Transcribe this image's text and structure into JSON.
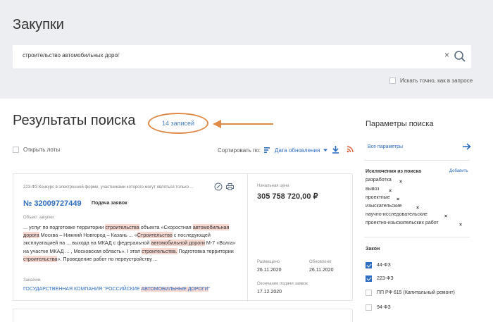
{
  "page": {
    "title": "Закупки"
  },
  "search": {
    "query": "строительство автомобильных дорог",
    "clear_icon": "close-icon",
    "exact_match_label": "Искать точно, как в запросе"
  },
  "results": {
    "title": "Результаты поиска",
    "count": "14 записей",
    "open_lots_label": "Открыть лоты",
    "sort_label": "Сортировать по:",
    "sort_value": "Дата обновления"
  },
  "card": {
    "type": "223-ФЗ Конкурс в электронной форме, участниками которого могут являться только ...",
    "number": "№ 32009727449",
    "status": "Подача заявок",
    "object_label": "Объект закупки",
    "object_parts": {
      "p1": "... услуг по подготовке территории ",
      "h1": "строительства",
      "p2": " объекта «Скоростная ",
      "h2": "автомобильная дорога",
      "p3": " Москва – Нижний Новгород – Казань ... «",
      "h3": "Строительство",
      "p4": " с последующей эксплуатацией на ... выхода на МКАД с федеральной ",
      "h4": "автомобильной дороги",
      "p5": " М-7 «Волга» на участке МКАД ... , Московская область». I этап ",
      "h5": "строительства.",
      "p6": " Подготовка территории ",
      "h6": "строительства",
      "p7": "». Проведение работ по переустройству ..."
    },
    "customer_label": "Заказчик",
    "customer_parts": {
      "p1": "ГОСУДАРСТВЕННАЯ КОМПАНИЯ \"РОССИЙСКИЕ ",
      "h1": "АВТОМОБИЛЬНЫЕ ДОРОГИ",
      "p2": "\""
    },
    "price_label": "Начальная цена",
    "price": "305 758 720,00 ₽",
    "placed_label": "Размещено",
    "placed": "26.11.2020",
    "updated_label": "Обновлено",
    "updated": "26.11.2020",
    "end_label": "Окончание подачи заявок",
    "end": "17.12.2020"
  },
  "sidebar": {
    "title": "Параметры поиска",
    "all_params": "Все параметры",
    "exclusions_title": "Исключения из поиска",
    "exclusions_add": "Добавить",
    "exclusions": [
      "разработка",
      "вывоз",
      "проектные",
      "изыскательские",
      "научно-исследовательские",
      "проектно-изыскательских работ"
    ],
    "remove_symbol": "×",
    "laws_title": "Закон",
    "laws": [
      {
        "label": "44-ФЗ",
        "checked": true
      },
      {
        "label": "223-ФЗ",
        "checked": true
      },
      {
        "label": "ПП РФ 615 (Капитальный ремонт)",
        "checked": false
      },
      {
        "label": "94-ФЗ",
        "checked": false
      }
    ]
  },
  "colors": {
    "accent": "#2e6dc0",
    "highlight": "#f6d8d1",
    "annotation": "#e08a4a",
    "header_bg": "#eceef1"
  }
}
